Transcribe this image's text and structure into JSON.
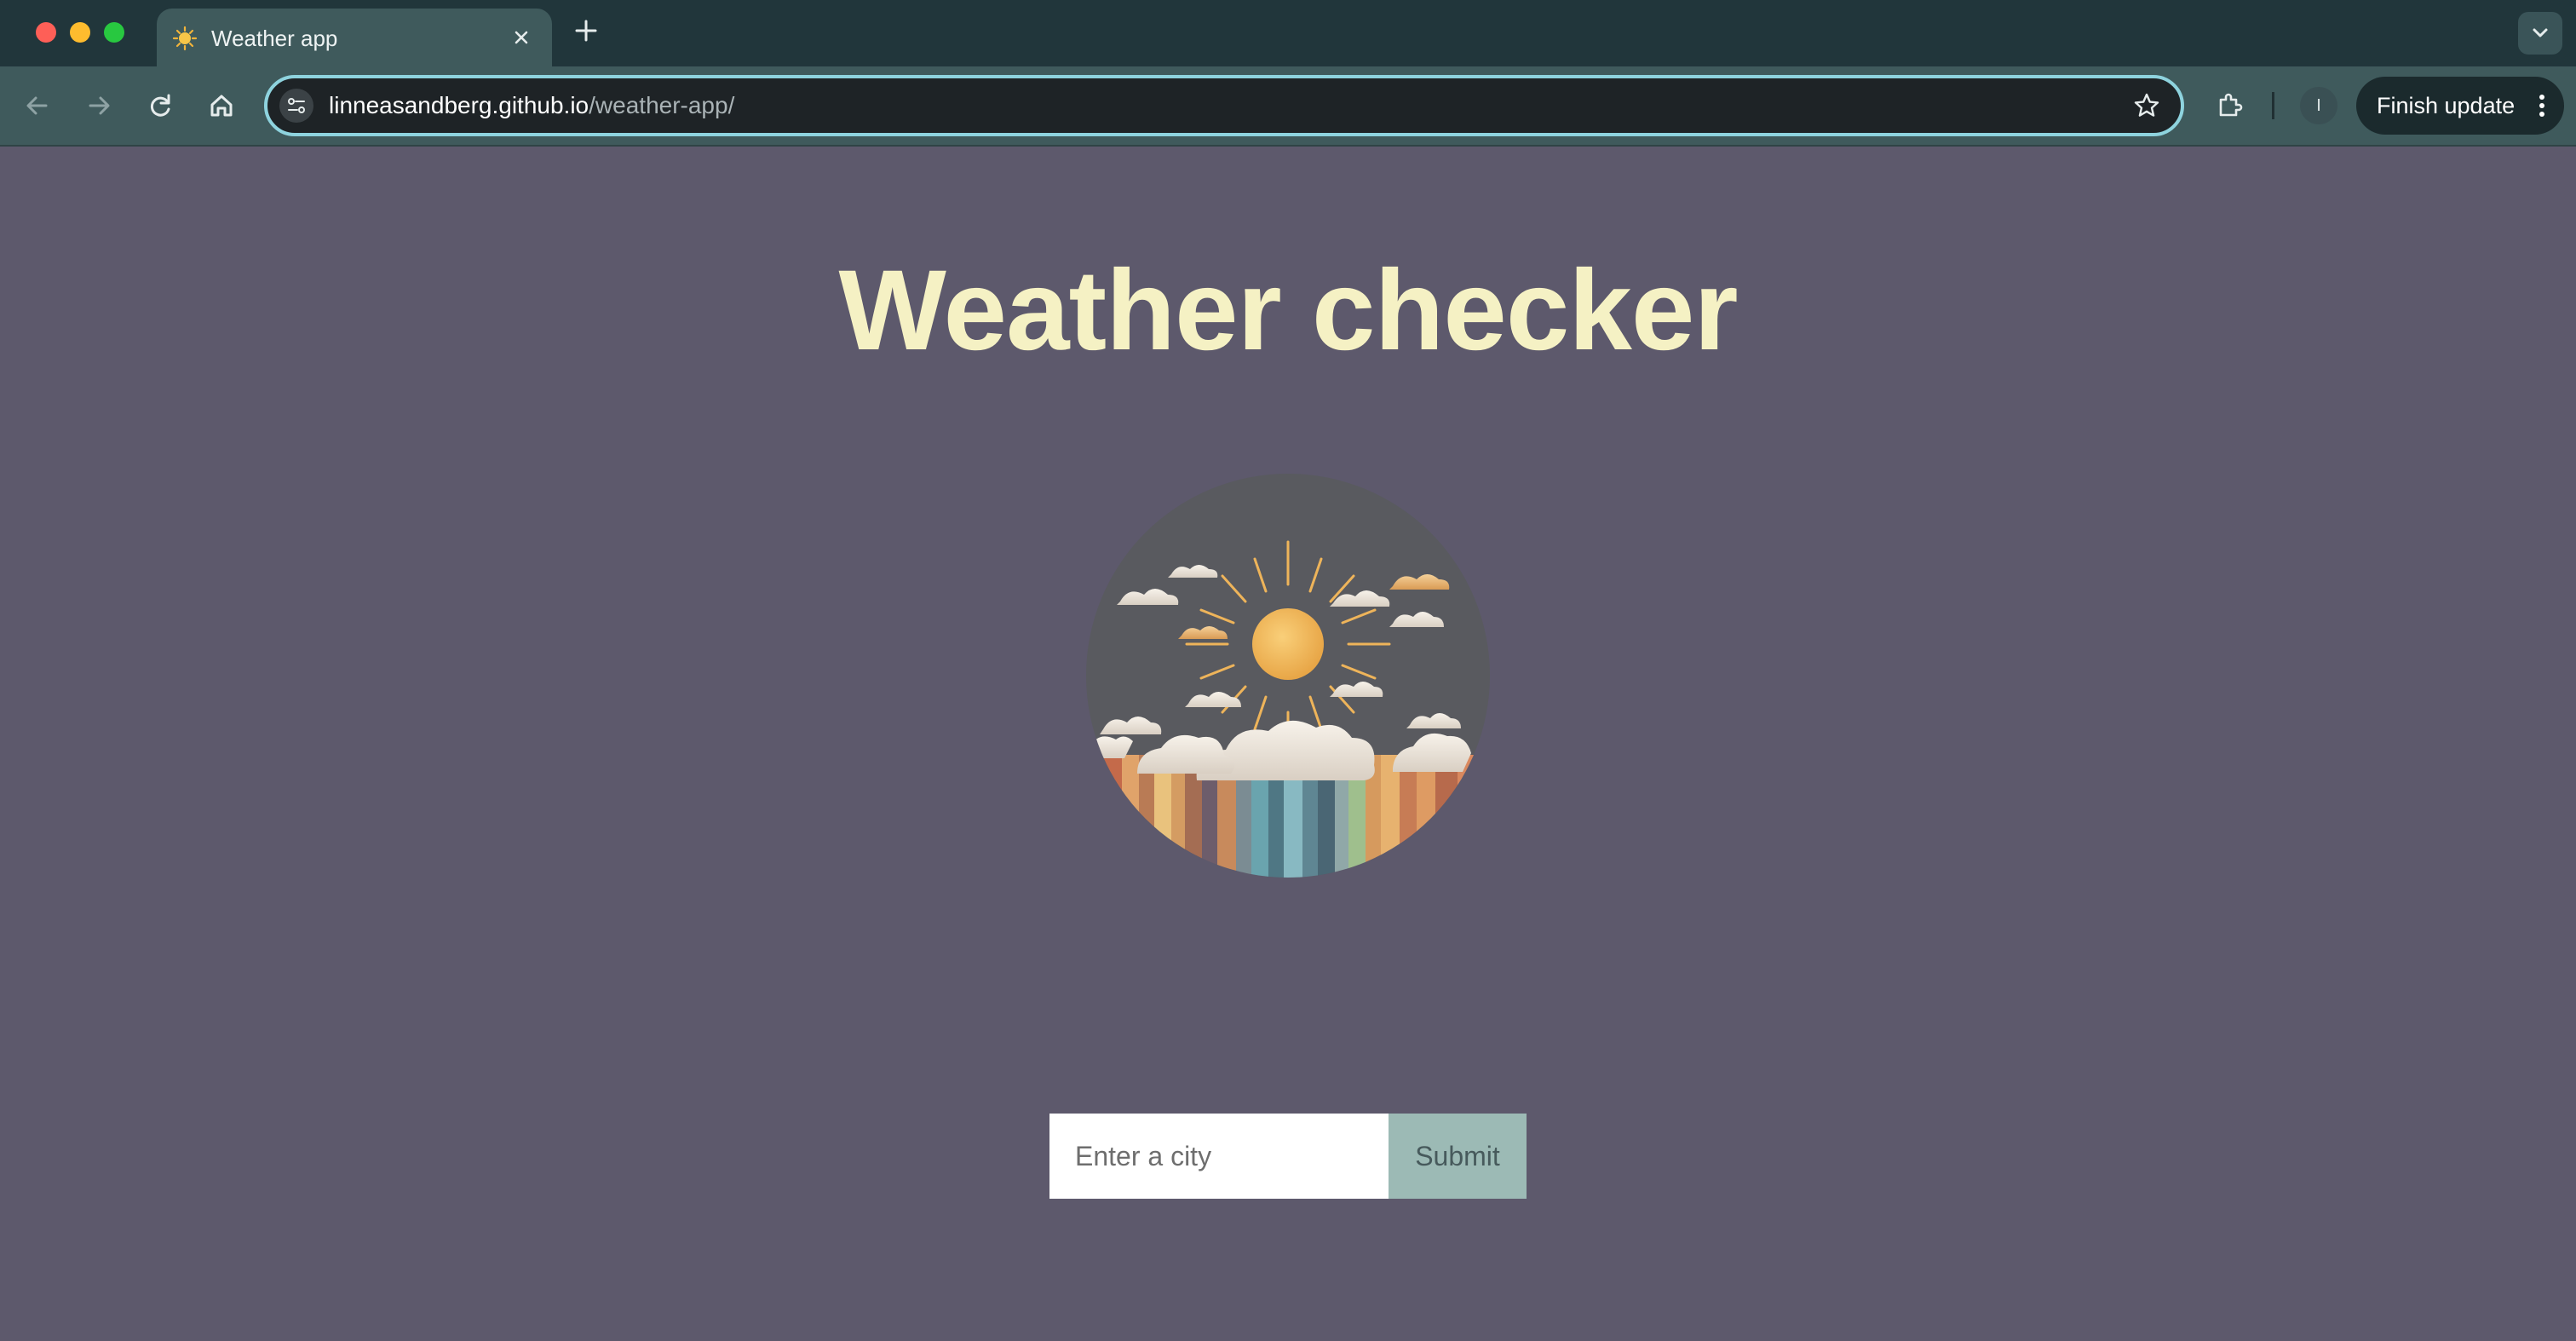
{
  "browser": {
    "tab": {
      "title": "Weather app",
      "favicon": "sun-icon"
    },
    "address": {
      "domain": "linneasandberg.github.io",
      "path": "/weather-app/"
    },
    "profile_initial": "I",
    "finish_update_label": "Finish update",
    "icons": [
      "arrow-left-icon",
      "arrow-right-icon",
      "reload-icon",
      "home-icon",
      "site-info-icon",
      "star-icon",
      "extensions-icon",
      "kebab-menu-icon",
      "close-icon",
      "plus-icon",
      "chevron-down-icon"
    ]
  },
  "page": {
    "title": "Weather checker",
    "illustration": "sun-and-clouds-illustration",
    "search": {
      "placeholder": "Enter a city",
      "value": "",
      "submit_label": "Submit"
    }
  },
  "colors": {
    "page_background": "#5d596c",
    "title": "#f5f1c4",
    "submit_button": "#9cbab5",
    "chrome_frame": "#21363b",
    "chrome_toolbar": "#3f5a5c",
    "omnibox_focus": "#8ed3de"
  }
}
